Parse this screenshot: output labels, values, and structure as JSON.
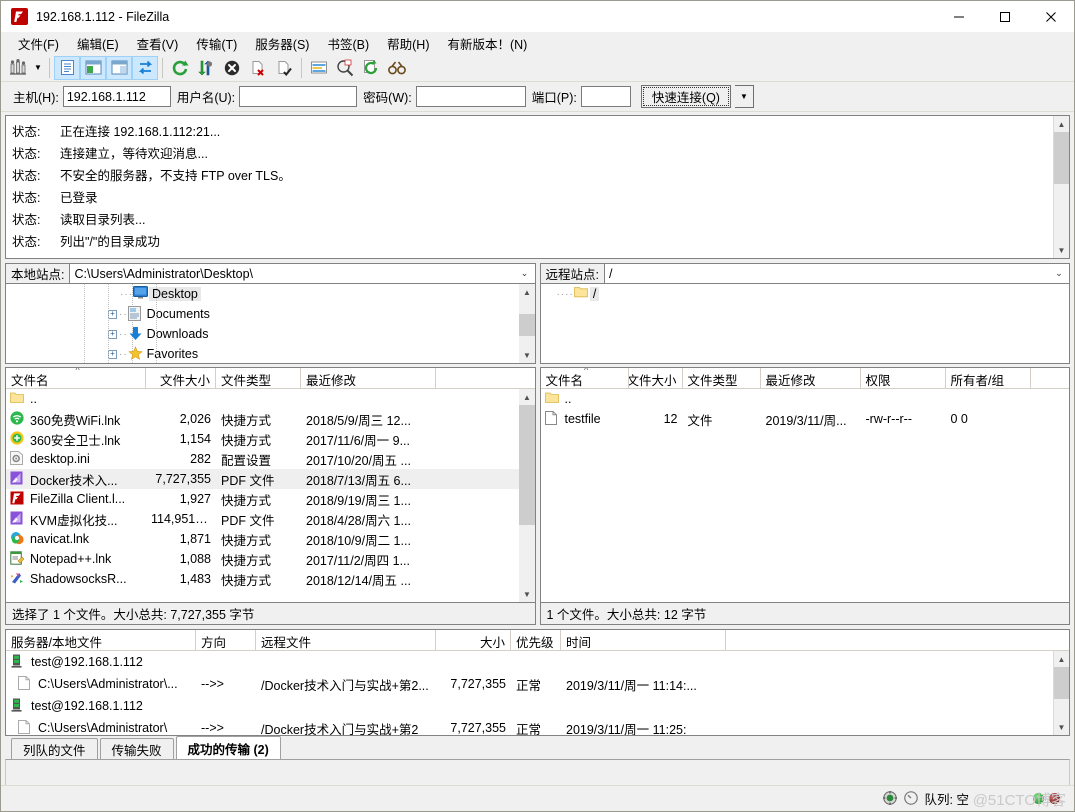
{
  "window": {
    "title": "192.168.1.112 - FileZilla",
    "app_icon": "filezilla-icon",
    "minimize": "—",
    "maximize": "☐",
    "close": "✕"
  },
  "menubar": [
    {
      "label": "文件(F)",
      "name": "menu-file"
    },
    {
      "label": "编辑(E)",
      "name": "menu-edit"
    },
    {
      "label": "查看(V)",
      "name": "menu-view"
    },
    {
      "label": "传输(T)",
      "name": "menu-transfer"
    },
    {
      "label": "服务器(S)",
      "name": "menu-server"
    },
    {
      "label": "书签(B)",
      "name": "menu-bookmarks"
    },
    {
      "label": "帮助(H)",
      "name": "menu-help"
    },
    {
      "label": "有新版本！(N)",
      "name": "menu-new-version"
    }
  ],
  "toolbar": {
    "items": [
      {
        "name": "site-manager-icon"
      },
      {
        "name": "dropdown-caret-icon"
      },
      {
        "name": "toggle-message-log-icon"
      },
      {
        "name": "toggle-local-tree-icon"
      },
      {
        "name": "toggle-remote-tree-icon"
      },
      {
        "name": "toggle-transfer-queue-icon"
      },
      {
        "name": "refresh-icon"
      },
      {
        "name": "process-queue-icon"
      },
      {
        "name": "cancel-icon"
      },
      {
        "name": "disconnect-icon"
      },
      {
        "name": "reconnect-icon"
      },
      {
        "name": "filter-icon"
      },
      {
        "name": "directory-compare-icon"
      },
      {
        "name": "synchronized-browsing-icon"
      },
      {
        "name": "search-remote-files-icon"
      }
    ]
  },
  "quickconnect": {
    "host_label": "主机(H):",
    "host_value": "192.168.1.112",
    "user_label": "用户名(U):",
    "user_value": "",
    "pass_label": "密码(W):",
    "pass_value": "",
    "port_label": "端口(P):",
    "port_value": "",
    "connect_label": "快速连接(Q)",
    "dropdown_icon": "chevron-down-icon"
  },
  "log": {
    "prefix": "状态:",
    "messages": [
      "正在连接 192.168.1.112:21...",
      "连接建立，等待欢迎消息...",
      "不安全的服务器，不支持 FTP over TLS。",
      "已登录",
      "读取目录列表...",
      "列出\"/\"的目录成功"
    ]
  },
  "local": {
    "site_label": "本地站点:",
    "site_path": "C:\\Users\\Administrator\\Desktop\\",
    "tree": [
      {
        "label": "Desktop",
        "icon": "desktop-icon",
        "expandable": false,
        "selected": true,
        "indent": 4
      },
      {
        "label": "Documents",
        "icon": "documents-icon",
        "expandable": true,
        "selected": false,
        "indent": 4
      },
      {
        "label": "Downloads",
        "icon": "downloads-icon",
        "expandable": true,
        "selected": false,
        "indent": 4
      },
      {
        "label": "Favorites",
        "icon": "favorites-icon",
        "expandable": true,
        "selected": false,
        "indent": 4
      }
    ],
    "columns": [
      "文件名",
      "文件大小",
      "文件类型",
      "最近修改"
    ],
    "rows": [
      {
        "name": "..",
        "icon": "folder-up-icon",
        "size": "",
        "type": "",
        "modified": "",
        "selected": false
      },
      {
        "name": "360免费WiFi.lnk",
        "icon": "wifi360-icon",
        "size": "2,026",
        "type": "快捷方式",
        "modified": "2018/5/9/周三 12...",
        "selected": false
      },
      {
        "name": "360安全卫士.lnk",
        "icon": "safe360-icon",
        "size": "1,154",
        "type": "快捷方式",
        "modified": "2017/11/6/周一 9...",
        "selected": false
      },
      {
        "name": "desktop.ini",
        "icon": "ini-file-icon",
        "size": "282",
        "type": "配置设置",
        "modified": "2017/10/20/周五 ...",
        "selected": false
      },
      {
        "name": "Docker技术入...",
        "icon": "pdf-file-icon",
        "size": "7,727,355",
        "type": "PDF 文件",
        "modified": "2018/7/13/周五 6...",
        "selected": true
      },
      {
        "name": "FileZilla Client.l...",
        "icon": "filezilla-icon",
        "size": "1,927",
        "type": "快捷方式",
        "modified": "2018/9/19/周三 1...",
        "selected": false
      },
      {
        "name": "KVM虚拟化技...",
        "icon": "pdf-file-icon",
        "size": "114,951,5...",
        "type": "PDF 文件",
        "modified": "2018/4/28/周六 1...",
        "selected": false
      },
      {
        "name": "navicat.lnk",
        "icon": "navicat-icon",
        "size": "1,871",
        "type": "快捷方式",
        "modified": "2018/10/9/周二 1...",
        "selected": false
      },
      {
        "name": "Notepad++.lnk",
        "icon": "notepadpp-icon",
        "size": "1,088",
        "type": "快捷方式",
        "modified": "2017/11/2/周四 1...",
        "selected": false
      },
      {
        "name": "ShadowsocksR...",
        "icon": "shadowsocks-icon",
        "size": "1,483",
        "type": "快捷方式",
        "modified": "2018/12/14/周五 ...",
        "selected": false
      }
    ],
    "status": "选择了 1 个文件。大小总共: 7,727,355 字节"
  },
  "remote": {
    "site_label": "远程站点:",
    "site_path": "/",
    "tree": [
      {
        "label": "/",
        "icon": "folder-icon",
        "selected": true
      }
    ],
    "columns": [
      "文件名",
      "文件大小",
      "文件类型",
      "最近修改",
      "权限",
      "所有者/组"
    ],
    "rows": [
      {
        "name": "..",
        "icon": "folder-up-icon",
        "size": "",
        "type": "",
        "modified": "",
        "perms": "",
        "owner": ""
      },
      {
        "name": "testfile",
        "icon": "generic-file-icon",
        "size": "12",
        "type": "文件",
        "modified": "2019/3/11/周...",
        "perms": "-rw-r--r--",
        "owner": "0 0"
      }
    ],
    "status": "1 个文件。大小总共: 12 字节"
  },
  "queue": {
    "columns": [
      "服务器/本地文件",
      "方向",
      "远程文件",
      "大小",
      "优先级",
      "时间"
    ],
    "rows": [
      {
        "kind": "server",
        "icon": "server-icon",
        "server": "test@192.168.1.112",
        "local": "",
        "direction": "",
        "remote": "",
        "size": "",
        "priority": "",
        "time": ""
      },
      {
        "kind": "file",
        "icon": "file-icon",
        "server": "",
        "local": "C:\\Users\\Administrator\\...",
        "direction": "-->>",
        "remote": "/Docker技术入门与实战+第2...",
        "size": "7,727,355",
        "priority": "正常",
        "time": "2019/3/11/周一 11:14:..."
      },
      {
        "kind": "server",
        "icon": "server-icon",
        "server": "test@192.168.1.112",
        "local": "",
        "direction": "",
        "remote": "",
        "size": "",
        "priority": "",
        "time": ""
      },
      {
        "kind": "file",
        "icon": "file-icon",
        "server": "",
        "local": "C:\\Users\\Administrator\\",
        "direction": "-->>",
        "remote": "/Docker技术入门与实战+第2",
        "size": "7,727,355",
        "priority": "正常",
        "time": "2019/3/11/周一 11:25:"
      }
    ]
  },
  "tabs": [
    {
      "label": "列队的文件",
      "active": false,
      "name": "tab-queued-files"
    },
    {
      "label": "传输失败",
      "active": false,
      "name": "tab-failed-transfers"
    },
    {
      "label": "成功的传输 (2)",
      "active": true,
      "name": "tab-successful-transfers"
    }
  ],
  "statusbar": {
    "queue_text": "队列: 空",
    "lock_icon": "lock-icon",
    "speed_icon": "speed-icon",
    "watermark": "@51CTO博客",
    "green_dot": "#2ea33a",
    "red_dot": "#8b2323"
  }
}
